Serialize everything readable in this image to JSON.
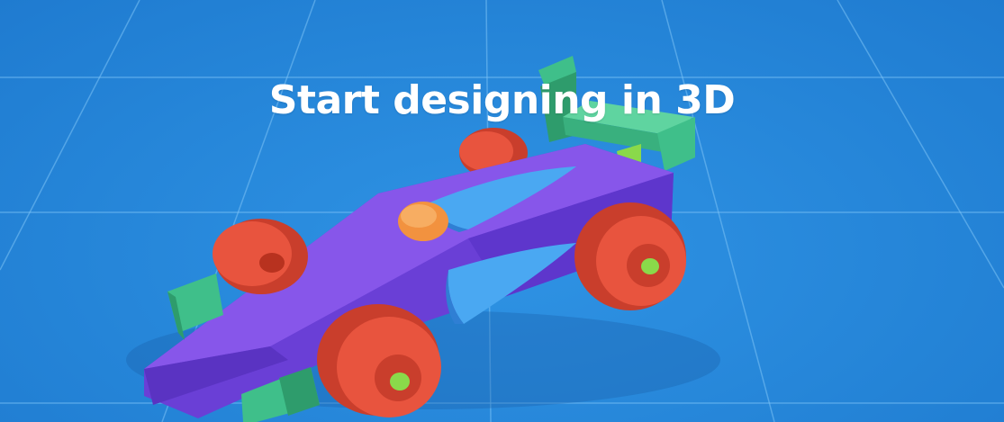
{
  "hero": {
    "headline": "Start designing in 3D",
    "background_color": "#2a8fe0"
  },
  "illustration": {
    "subject": "toy race car",
    "colors": {
      "body": "#7a4fe0",
      "wheels": "#e8543e",
      "wings": "#3fbf8a",
      "cockpit": "#4aa8f2",
      "helmet": "#f2923f",
      "axle": "#8ad94a"
    }
  }
}
